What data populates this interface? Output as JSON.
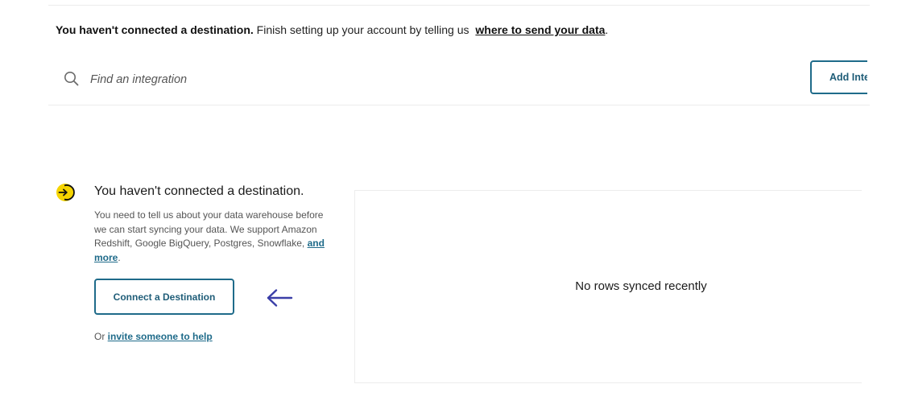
{
  "banner": {
    "bold_text": "You haven't connected a destination.",
    "text": " Finish setting up your account by telling us ",
    "link": "where to send your data",
    "suffix": "."
  },
  "search": {
    "placeholder": "Find an integration",
    "icon": "search-icon"
  },
  "toolbar": {
    "add_integration_label": "Add Inte"
  },
  "empty_state": {
    "icon": "sign-in-arrow-icon",
    "icon_color": "#f5d400",
    "title": "You haven't connected a destination.",
    "description": "You need to tell us about your data warehouse before we can start syncing your data. We support Amazon Redshift, Google BigQuery, Postgres, Snowflake, ",
    "description_link": "and more",
    "description_suffix": ".",
    "connect_button": "Connect a Destination",
    "pointer_icon": "arrow-left-icon",
    "pointer_color": "#3b3fa8",
    "help_prefix": "Or ",
    "help_link": "invite someone to help"
  },
  "sync_panel": {
    "message": "No rows synced recently"
  },
  "colors": {
    "accent": "#1f6b8a",
    "border": "#ececec"
  }
}
